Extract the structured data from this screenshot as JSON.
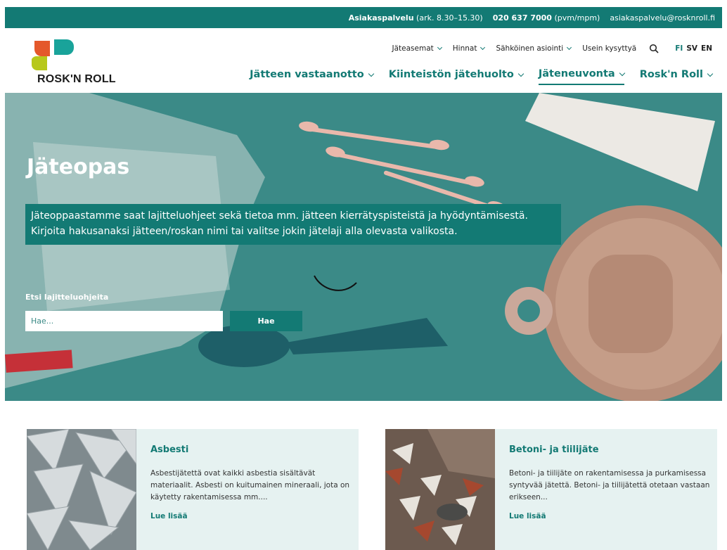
{
  "topbar": {
    "service_label": "Asiakaspalvelu",
    "service_hours": "(ark. 8.30–15.30)",
    "phone": "020 637 7000",
    "phone_note": "(pvm/mpm)",
    "email": "asiakaspalvelu@rosknroll.fi"
  },
  "logo": {
    "text": "ROSK'N ROLL"
  },
  "util_nav": {
    "items": [
      {
        "label": "Jäteasemat",
        "dropdown": true
      },
      {
        "label": "Hinnat",
        "dropdown": true
      },
      {
        "label": "Sähköinen asiointi",
        "dropdown": true
      },
      {
        "label": "Usein kysyttyä",
        "dropdown": false
      }
    ],
    "languages": [
      "FI",
      "SV",
      "EN"
    ],
    "active_language": "FI"
  },
  "main_nav": {
    "items": [
      {
        "label": "Jätteen vastaanotto"
      },
      {
        "label": "Kiinteistön jätehuolto"
      },
      {
        "label": "Jäteneuvonta"
      },
      {
        "label": "Rosk'n Roll"
      }
    ],
    "active": "Jäteneuvonta"
  },
  "hero": {
    "title": "Jäteopas",
    "intro_line1": "Jäteoppaastamme saat lajitteluohjeet sekä tietoa mm. jätteen kierrätyspisteistä ja hyödyntämisestä.",
    "intro_line2": "Kirjoita hakusanaksi jätteen/roskan nimi tai valitse jokin jätelaji alla olevasta valikosta.",
    "search_label": "Etsi lajitteluohjeita",
    "search_placeholder": "Hae...",
    "search_button": "Hae"
  },
  "cards": [
    {
      "title": "Asbesti",
      "text": "Asbestijätettä ovat kaikki asbestia sisältävät materiaalit. Asbesti on kuitumainen mineraali, jota on käytetty rakentamisessa mm....",
      "link": "Lue lisää"
    },
    {
      "title": "Betoni- ja tiilijäte",
      "text": "Betoni- ja tiilijäte on rakentamisessa ja purkamisessa syntyvää jätettä. Betoni- ja tiilijätettä otetaan vastaan erikseen...",
      "link": "Lue lisää"
    }
  ],
  "colors": {
    "brand": "#137a74",
    "hero_bg": "#3b8a87",
    "card_bg": "#e6f2f1",
    "logo_orange": "#e4582b",
    "logo_teal": "#19a39a",
    "logo_green": "#b7c81c"
  }
}
